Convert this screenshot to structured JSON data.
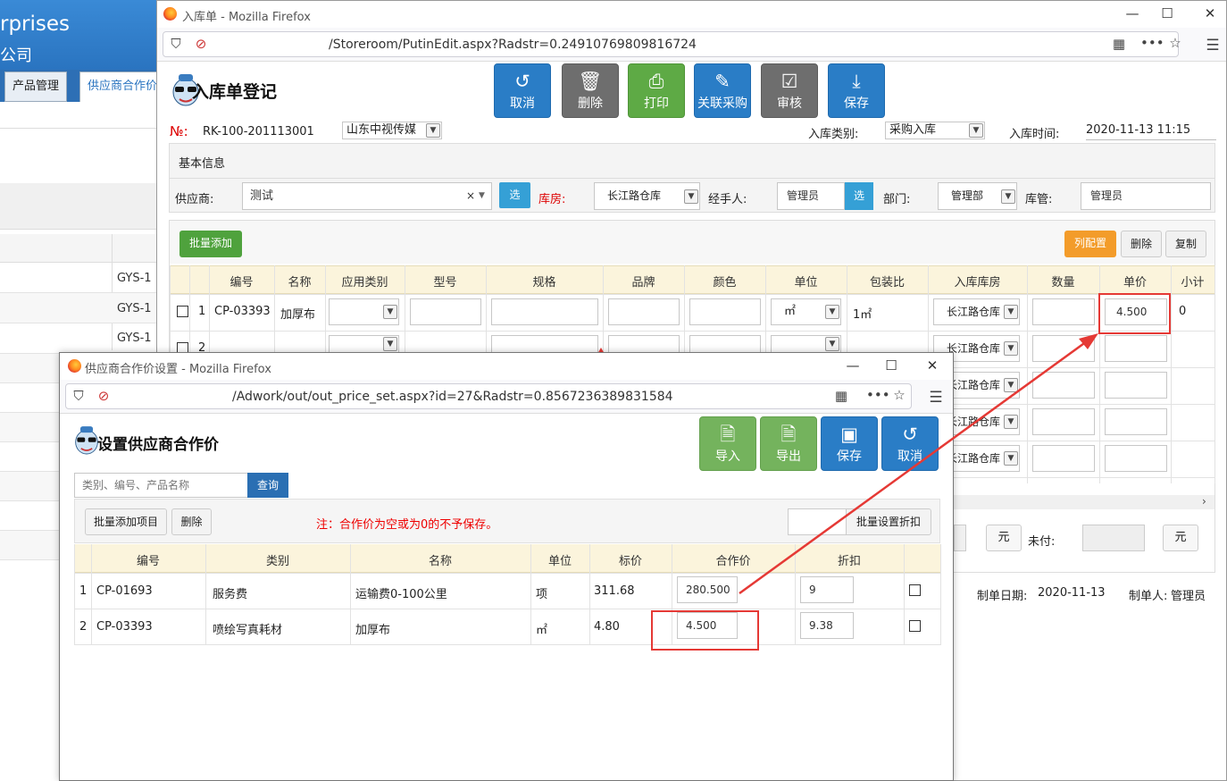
{
  "background_app": {
    "banner_line1": "rprises",
    "banner_line2": "公司",
    "tabs": [
      "产品管理",
      "供应商合作价"
    ],
    "row_codes": [
      "GYS-1",
      "GYS-1",
      "GYS-1"
    ]
  },
  "main_window": {
    "title": "入库单 - Mozilla Firefox",
    "url": "/Storeroom/PutinEdit.aspx?Radstr=0.24910769809816724",
    "page_title": "入库单登记",
    "toolbar": [
      {
        "label": "取消",
        "icon": "undo-icon"
      },
      {
        "label": "删除",
        "icon": "trash-icon"
      },
      {
        "label": "打印",
        "icon": "printer-icon"
      },
      {
        "label": "关联采购",
        "icon": "paperclip-icon"
      },
      {
        "label": "审核",
        "icon": "check-icon"
      },
      {
        "label": "保存",
        "icon": "download-icon"
      }
    ],
    "order_label": "№:",
    "order_no": "RK-100-201113001",
    "company_select": "山东中视传媒",
    "type_label": "入库类别:",
    "type_value": "采购入库",
    "time_label": "入库时间:",
    "time_value": "2020-11-13 11:15",
    "basic_info": "基本信息",
    "supplier_label": "供应商:",
    "supplier_value": "测试",
    "pick_label": "选",
    "warehouse_label": "库房:",
    "warehouse_value": "长江路仓库",
    "handler_label": "经手人:",
    "handler_value": "管理员",
    "dept_label": "部门:",
    "dept_value": "管理部",
    "keeper_label": "库管:",
    "keeper_value": "管理员",
    "batch_add": "批量添加",
    "col_config": "列配置",
    "delete": "删除",
    "copy": "复制",
    "columns": [
      "编号",
      "名称",
      "应用类别",
      "型号",
      "规格",
      "品牌",
      "颜色",
      "单位",
      "包装比",
      "入库库房",
      "数量",
      "单价",
      "小计"
    ],
    "row1": {
      "idx": "1",
      "code": "CP-03393",
      "name": "加厚布",
      "unit": "㎡",
      "pack": "1㎡",
      "warehouse": "长江路仓库",
      "price": "4.500",
      "subtotal": "0"
    },
    "row2_idx": "2",
    "yuan": "元",
    "unpaid_label": "未付:",
    "made_date_label": "制单日期:",
    "made_date": "2020-11-13",
    "maker_label": "制单人:",
    "maker": "管理员"
  },
  "popup_window": {
    "title": "供应商合作价设置 - Mozilla Firefox",
    "url": "/Adwork/out/out_price_set.aspx?id=27&Radstr=0.8567236389831584",
    "page_title": "设置供应商合作价",
    "toolbar": [
      {
        "label": "导入",
        "icon": "file-import-icon"
      },
      {
        "label": "导出",
        "icon": "file-export-icon"
      },
      {
        "label": "保存",
        "icon": "floppy-icon"
      },
      {
        "label": "取消",
        "icon": "undo-icon"
      }
    ],
    "search_placeholder": "类别、编号、产品名称",
    "query": "查询",
    "batch_add_items": "批量添加项目",
    "delete": "删除",
    "note": "注：合作价为空或为0的不予保存。",
    "batch_discount": "批量设置折扣",
    "columns": [
      "编号",
      "类别",
      "名称",
      "单位",
      "标价",
      "合作价",
      "折扣"
    ],
    "rows": [
      {
        "idx": "1",
        "code": "CP-01693",
        "category": "服务费",
        "name": "运输费0-100公里",
        "unit": "项",
        "list_price": "311.68",
        "coop_price": "280.500",
        "discount": "9"
      },
      {
        "idx": "2",
        "code": "CP-03393",
        "category": "喷绘写真耗材",
        "name": "加厚布",
        "unit": "㎡",
        "list_price": "4.80",
        "coop_price": "4.500",
        "discount": "9.38"
      }
    ]
  },
  "colors": {
    "primary_blue": "#2a7dc6",
    "green": "#5eaa45",
    "orange": "#f39c2a",
    "highlight_red": "#e53935"
  }
}
